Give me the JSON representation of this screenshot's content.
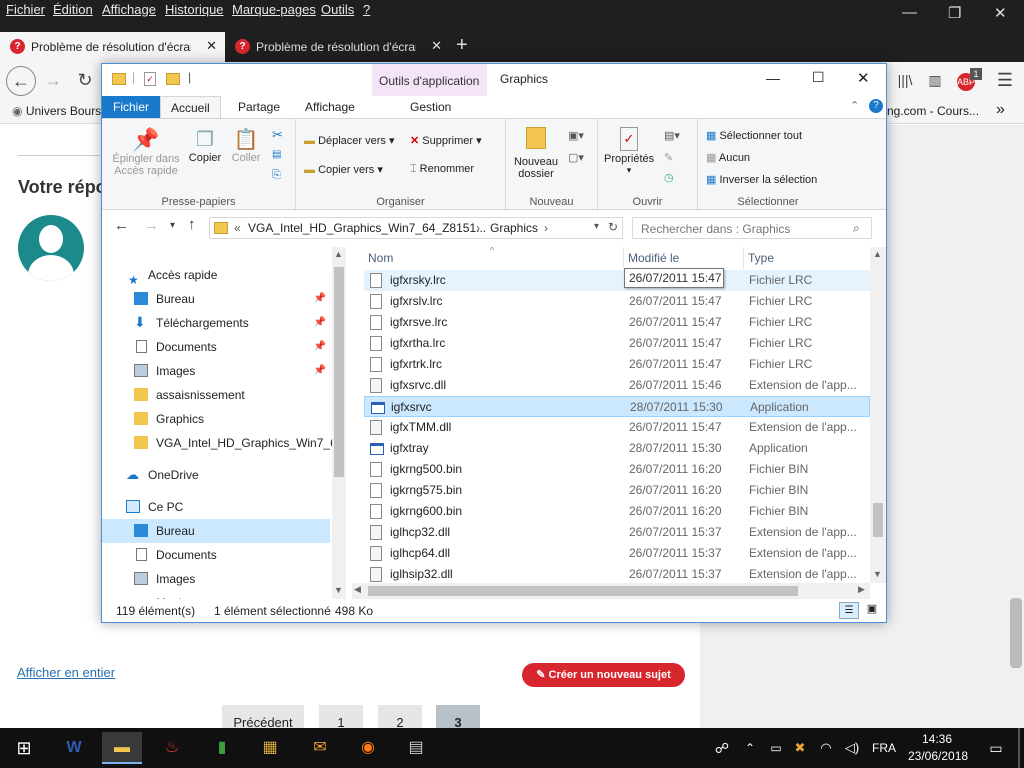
{
  "firefox": {
    "menu": [
      "Fichier",
      "Édition",
      "Affichage",
      "Historique",
      "Marque-pages",
      "Outils",
      "?"
    ],
    "tabs": [
      {
        "title": "Problème de résolution d'écran"
      },
      {
        "title": "Problème de résolution d'écran"
      }
    ],
    "bookmark": "Univers Bours",
    "bookmark_right": "ng.com - Cours...",
    "ext_badge": "1"
  },
  "forum": {
    "heading": "Votre répo",
    "show_all": "Afficher en entier",
    "new_topic": "Créer un nouveau sujet",
    "pages": [
      "Précédent",
      "1",
      "2",
      "3"
    ]
  },
  "explorer": {
    "title": "Graphics",
    "context_tab": "Outils d'application",
    "ribbon_tabs": [
      "Fichier",
      "Accueil",
      "Partage",
      "Affichage",
      "Gestion"
    ],
    "ribbon": {
      "pin": "Épingler dans Accès rapide",
      "copy": "Copier",
      "paste": "Coller",
      "g_clipboard": "Presse-papiers",
      "move_to": "Déplacer vers",
      "copy_to": "Copier vers",
      "delete": "Supprimer",
      "rename": "Renommer",
      "g_organize": "Organiser",
      "new_folder": "Nouveau dossier",
      "g_new": "Nouveau",
      "properties": "Propriétés",
      "g_open": "Ouvrir",
      "select_all": "Sélectionner tout",
      "select_none": "Aucun",
      "invert": "Inverser la sélection",
      "g_select": "Sélectionner"
    },
    "address": {
      "prefix": "«",
      "part1": "VGA_Intel_HD_Graphics_Win7_64_Z8151...",
      "part2": "Graphics"
    },
    "search_placeholder": "Rechercher dans : Graphics",
    "nav": [
      {
        "label": "Accès rapide",
        "pinned": false
      },
      {
        "label": "Bureau",
        "pinned": true
      },
      {
        "label": "Téléchargements",
        "pinned": true
      },
      {
        "label": "Documents",
        "pinned": true
      },
      {
        "label": "Images",
        "pinned": true
      },
      {
        "label": "assaisnissement",
        "pinned": false
      },
      {
        "label": "Graphics",
        "pinned": false
      },
      {
        "label": "VGA_Intel_HD_Graphics_Win7_64_",
        "pinned": false
      },
      {
        "label": "OneDrive",
        "pinned": false
      },
      {
        "label": "Ce PC",
        "pinned": false
      },
      {
        "label": "Bureau",
        "pinned": false
      },
      {
        "label": "Documents",
        "pinned": false
      },
      {
        "label": "Images",
        "pinned": false
      },
      {
        "label": "Musique",
        "pinned": false
      }
    ],
    "columns": {
      "name": "Nom",
      "modified": "Modifié le",
      "type": "Type"
    },
    "tooltip": "26/07/2011 15:47",
    "files": [
      {
        "name": "igfxrsky.lrc",
        "date": "26/07/2011 15:47",
        "type": "Fichier LRC"
      },
      {
        "name": "igfxrslv.lrc",
        "date": "26/07/2011 15:47",
        "type": "Fichier LRC"
      },
      {
        "name": "igfxrsve.lrc",
        "date": "26/07/2011 15:47",
        "type": "Fichier LRC"
      },
      {
        "name": "igfxrtha.lrc",
        "date": "26/07/2011 15:47",
        "type": "Fichier LRC"
      },
      {
        "name": "igfxrtrk.lrc",
        "date": "26/07/2011 15:47",
        "type": "Fichier LRC"
      },
      {
        "name": "igfxsrvc.dll",
        "date": "26/07/2011 15:46",
        "type": "Extension de l'app..."
      },
      {
        "name": "igfxsrvc",
        "date": "28/07/2011 15:30",
        "type": "Application"
      },
      {
        "name": "igfxTMM.dll",
        "date": "26/07/2011 15:47",
        "type": "Extension de l'app..."
      },
      {
        "name": "igfxtray",
        "date": "28/07/2011 15:30",
        "type": "Application"
      },
      {
        "name": "igkrng500.bin",
        "date": "26/07/2011 16:20",
        "type": "Fichier BIN"
      },
      {
        "name": "igkrng575.bin",
        "date": "26/07/2011 16:20",
        "type": "Fichier BIN"
      },
      {
        "name": "igkrng600.bin",
        "date": "26/07/2011 16:20",
        "type": "Fichier BIN"
      },
      {
        "name": "iglhcp32.dll",
        "date": "26/07/2011 15:37",
        "type": "Extension de l'app..."
      },
      {
        "name": "iglhcp64.dll",
        "date": "26/07/2011 15:37",
        "type": "Extension de l'app..."
      },
      {
        "name": "iglhsip32.dll",
        "date": "26/07/2011 15:37",
        "type": "Extension de l'app..."
      }
    ],
    "selected_row": 6,
    "status": {
      "count": "119 élément(s)",
      "selected": "1 élément sélectionné",
      "size": "498 Ko"
    }
  },
  "taskbar": {
    "lang": "FRA",
    "time": "14:36",
    "date": "23/06/2018"
  },
  "colors": {
    "accent": "#1979ca",
    "selection": "#cce8ff",
    "red_button": "#d8262f"
  }
}
